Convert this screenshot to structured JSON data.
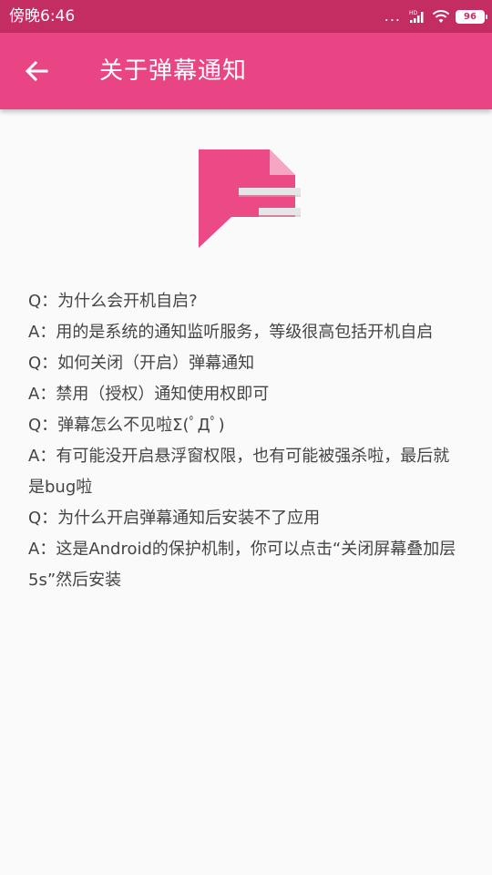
{
  "status_bar": {
    "time": "傍晚6:46",
    "dots": "...",
    "network_badge": "HD",
    "battery": "96"
  },
  "app_bar": {
    "title": "关于弹幕通知"
  },
  "faq": [
    "Q：为什么会开机自启?",
    "A：用的是系统的通知监听服务，等级很高包括开机自启",
    "Q：如何关闭（开启）弹幕通知",
    "A：禁用（授权）通知使用权即可",
    "Q：弹幕怎么不见啦Σ(ﾟДﾟ)",
    "A：有可能没开启悬浮窗权限，也有可能被强杀啦，最后就是bug啦",
    "Q：为什么开启弹幕通知后安装不了应用",
    "A：这是Android的保护机制，你可以点击“关闭屏幕叠加层5s”然后安装"
  ],
  "colors": {
    "status_bar": "#c42d62",
    "app_bar": "#e94584",
    "logo_pink": "#ec4a86",
    "logo_fold": "#f4a6c3",
    "logo_lines": "#e6e6e6",
    "text": "#444444"
  },
  "icons": {
    "back": "arrow-back-icon",
    "logo": "danmaku-notification-logo",
    "signal": "signal-icon",
    "wifi": "wifi-icon",
    "battery": "battery-icon"
  }
}
